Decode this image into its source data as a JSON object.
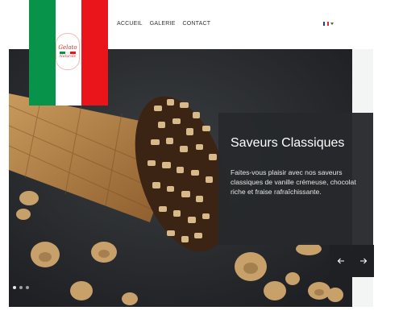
{
  "nav": {
    "links": [
      "ACCUEIL",
      "GALERIE",
      "CONTACT"
    ],
    "language_flag": "french-flag-icon"
  },
  "logo": {
    "top_text": "Gelato",
    "bottom_text": "Naturale",
    "flag_colors": [
      "#079349",
      "#ffffff",
      "#e9151b"
    ]
  },
  "slide": {
    "title": "Saveurs Classiques",
    "text": "Faites-vous plaisir avec nos saveurs classiques de vanille crémeuse, chocolat riche et fraise rafraîchissante."
  },
  "carousel": {
    "prev_icon": "arrow-left-icon",
    "next_icon": "arrow-right-icon",
    "slide_count": 3,
    "active_index": 0
  },
  "colors": {
    "caption_bg": "#26292c",
    "hero_bg": "#2a2d30"
  }
}
